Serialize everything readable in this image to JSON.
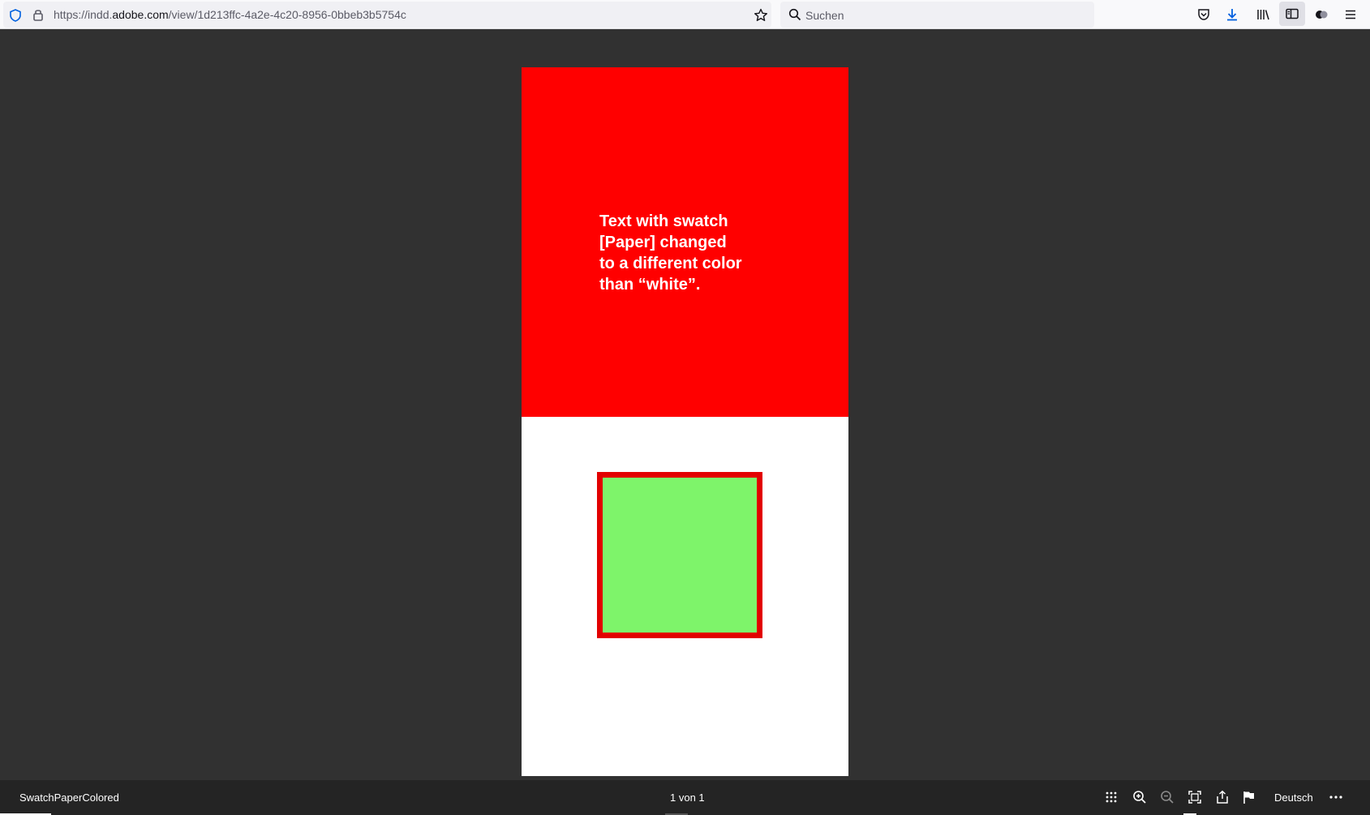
{
  "browser": {
    "url_prefix": "https://indd.",
    "url_domain": "adobe.com",
    "url_path": "/view/1d213ffc-4a2e-4c20-8956-0bbeb3b5754c",
    "search_placeholder": "Suchen",
    "icons": [
      "shield-icon",
      "lock-icon",
      "star-icon",
      "search-icon",
      "pocket-icon",
      "download-icon",
      "library-icon",
      "sidebar-icon",
      "extensions-icon",
      "menu-icon"
    ]
  },
  "document": {
    "page_text_lines": [
      "Text with swatch",
      "[Paper] changed",
      "to a different color",
      "than “white”."
    ],
    "colors": {
      "paper": "#ff0000",
      "page_bottom": "#ffffff",
      "box_fill": "#7ef46a",
      "box_stroke": "#e20000",
      "viewer_bg": "#313131"
    }
  },
  "viewer": {
    "title": "SwatchPaperColored",
    "page_indicator": "1 von 1",
    "language": "Deutsch",
    "icons": [
      "grid-icon",
      "zoom-in-icon",
      "zoom-out-icon",
      "fit-page-icon",
      "share-icon",
      "flag-icon",
      "more-icon"
    ]
  }
}
